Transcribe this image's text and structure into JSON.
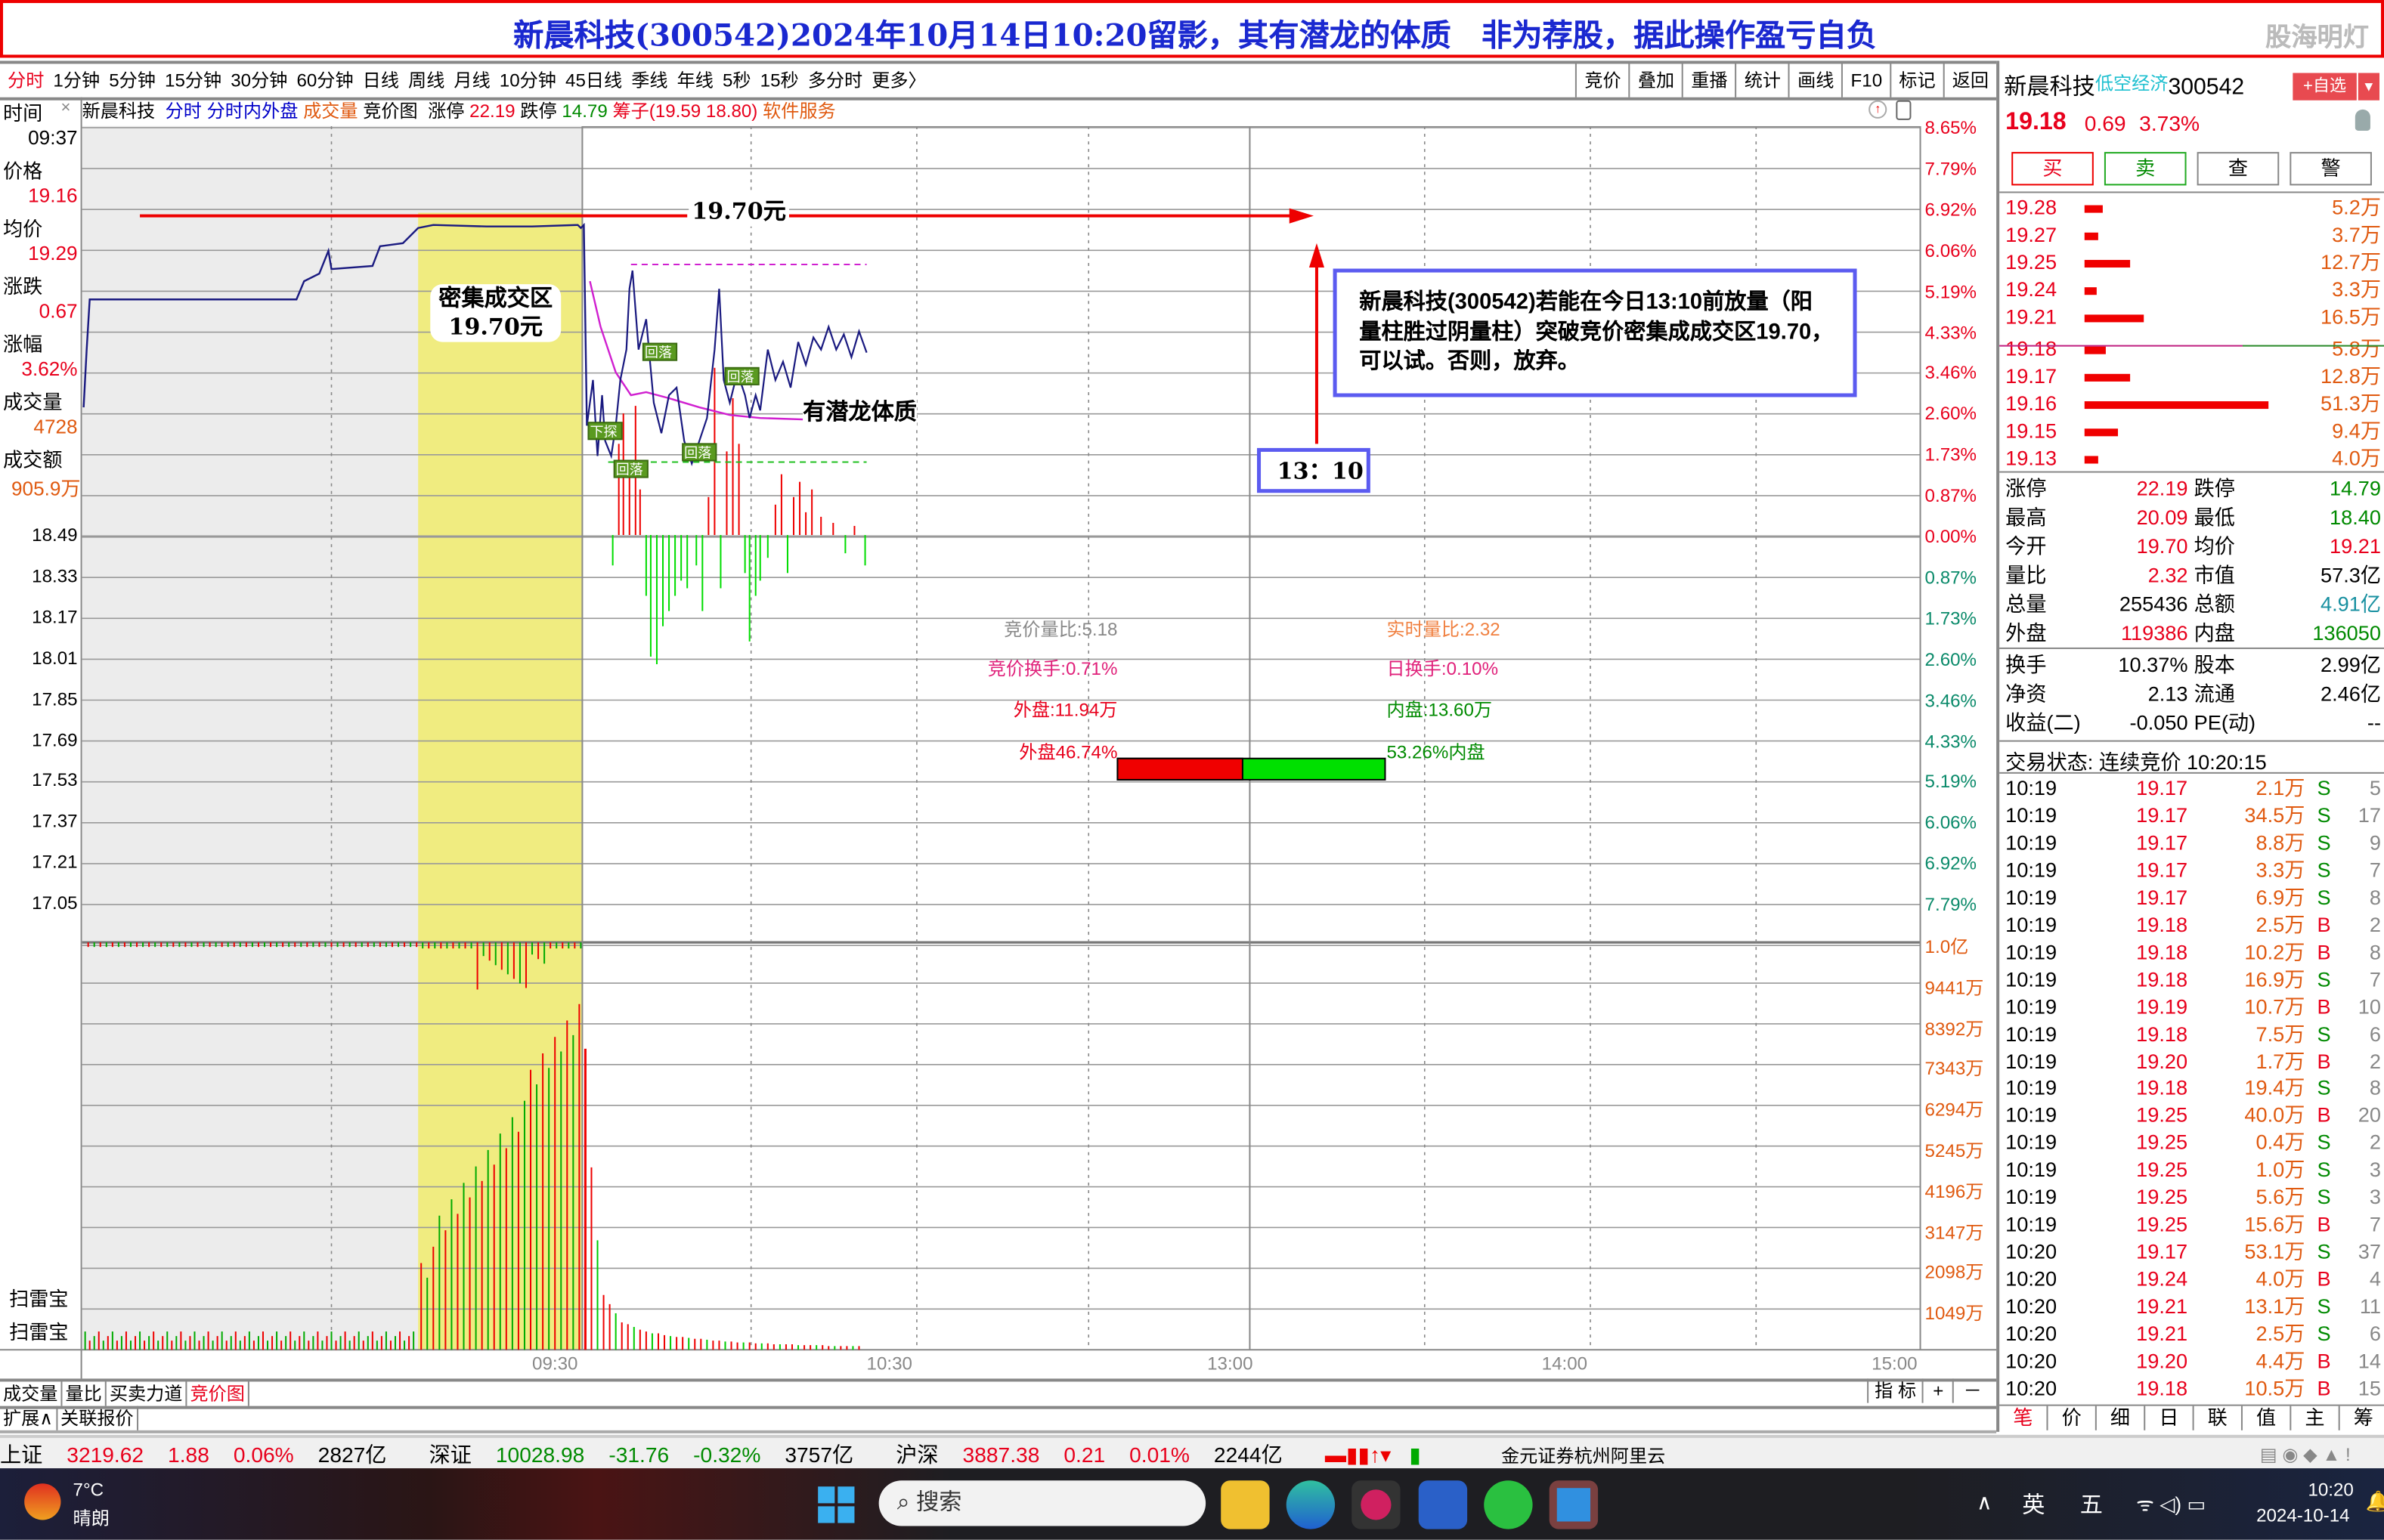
{
  "title": "新晨科技(300542)2024年10月14日10:20留影，其有潜龙的体质　非为荐股，据此操作盈亏自负",
  "watermark": "股海明灯",
  "periods": [
    "分时",
    "1分钟",
    "5分钟",
    "15分钟",
    "30分钟",
    "60分钟",
    "日线",
    "周线",
    "月线",
    "10分钟",
    "45日线",
    "季线",
    "年线",
    "5秒",
    "15秒",
    "多分时",
    "更多〉"
  ],
  "active_period": "分时",
  "tool_buttons": [
    "竞价",
    "叠加",
    "重播",
    "统计",
    "画线",
    "F10",
    "标记",
    "返回"
  ],
  "info_line": {
    "name": "新晨科技",
    "tab1": "分时",
    "tab2": "分时内外盘",
    "tab3": "成交量",
    "tab4": "竞价图",
    "limit_up_label": "涨停",
    "limit_up": "22.19",
    "limit_down_label": "跌停",
    "limit_down": "14.79",
    "chips": "筹子(19.59 18.80)",
    "service": "软件服务"
  },
  "left_panel": {
    "time_label": "时间",
    "time": "09:37",
    "price_label": "价格",
    "price": "19.16",
    "avg_label": "均价",
    "avg": "19.29",
    "change_label": "涨跌",
    "change": "0.67",
    "pct_label": "涨幅",
    "pct": "3.62%",
    "vol_label": "成交量",
    "vol": "4728",
    "amt_label": "成交额",
    "amt": "905.9万",
    "price_ticks_below": [
      "18.49",
      "18.33",
      "18.17",
      "18.01",
      "17.85",
      "17.69",
      "17.53",
      "17.37",
      "17.21",
      "17.05"
    ],
    "sweep1": "扫雷宝",
    "sweep2": "扫雷宝"
  },
  "right_axis": {
    "pct_up": [
      "8.65%",
      "7.79%",
      "6.92%",
      "6.06%",
      "5.19%",
      "4.33%",
      "3.46%",
      "2.60%",
      "1.73%",
      "0.87%",
      "0.00%"
    ],
    "pct_down": [
      "0.87%",
      "1.73%",
      "2.60%",
      "3.46%",
      "4.33%",
      "5.19%",
      "6.06%",
      "6.92%",
      "7.79%"
    ],
    "volume": [
      "1.0亿",
      "9441万",
      "8392万",
      "7343万",
      "6294万",
      "5245万",
      "4196万",
      "3147万",
      "2098万",
      "1049万"
    ]
  },
  "time_axis": [
    "09:30",
    "10:30",
    "13:00",
    "14:00",
    "15:00"
  ],
  "annotations": {
    "price_line_label": "19.70元",
    "zone_label_1": "密集成交区",
    "zone_label_2": "19.70元",
    "dragon": "有潜龙体质",
    "deadline": "13：10",
    "note": "新晨科技(300542)若能在今日13:10前放量（阳量柱胜过阴量柱）突破竞价密集成成交区19.70，可以试。否则，放弃。",
    "markers": [
      "下探",
      "回落",
      "回落",
      "回落",
      "回落"
    ]
  },
  "auction_stats": {
    "auction_ratio": "竞价量比:5.18",
    "realtime_ratio": "实时量比:2.32",
    "auction_turnover": "竞价换手:0.71%",
    "day_turnover": "日换手:0.10%",
    "outer": "外盘:11.94万",
    "inner": "内盘:13.60万",
    "outer_pct_label": "外盘46.74%",
    "inner_pct_label": "53.26%内盘",
    "outer_pct": 46.74
  },
  "bottom_tabs": [
    "成交量",
    "量比",
    "买卖力道",
    "竞价图"
  ],
  "active_bottom_tab": "竞价图",
  "ext_tabs": [
    "扩展∧",
    "关联报价"
  ],
  "indicator_buttons": [
    "指 标",
    "+",
    "－"
  ],
  "quote": {
    "name": "新晨科技",
    "concept": "低空经济",
    "code": "300542",
    "fav": "+自选",
    "price": "19.18",
    "change": "0.69",
    "pct": "3.73%",
    "actions": [
      "买",
      "卖",
      "查",
      "警"
    ],
    "asks": [
      [
        "19.28",
        "5.2万",
        5.2
      ],
      [
        "19.27",
        "3.7万",
        3.7
      ],
      [
        "19.25",
        "12.7万",
        12.7
      ],
      [
        "19.24",
        "3.3万",
        3.3
      ],
      [
        "19.21",
        "16.5万",
        16.5
      ]
    ],
    "bids": [
      [
        "19.18",
        "5.8万",
        5.8
      ],
      [
        "19.17",
        "12.8万",
        12.8
      ],
      [
        "19.16",
        "51.3万",
        51.3
      ],
      [
        "19.15",
        "9.4万",
        9.4
      ],
      [
        "19.13",
        "4.0万",
        4.0
      ]
    ],
    "stats": [
      [
        "涨停",
        "22.19",
        "red",
        "跌停",
        "14.79",
        "green"
      ],
      [
        "最高",
        "20.09",
        "red",
        "最低",
        "18.40",
        "green"
      ],
      [
        "今开",
        "19.70",
        "red",
        "均价",
        "19.21",
        "red"
      ],
      [
        "量比",
        "2.32",
        "red",
        "市值",
        "57.3亿",
        "black"
      ],
      [
        "总量",
        "255436",
        "black",
        "总额",
        "4.91亿",
        "teal"
      ],
      [
        "外盘",
        "119386",
        "red",
        "内盘",
        "136050",
        "green"
      ]
    ],
    "stats2": [
      [
        "换手",
        "10.37%",
        "black",
        "股本",
        "2.99亿",
        "black"
      ],
      [
        "净资",
        "2.13",
        "black",
        "流通",
        "2.46亿",
        "black"
      ],
      [
        "收益(二)",
        "-0.050",
        "black",
        "PE(动)",
        "--",
        "black"
      ]
    ],
    "status": "交易状态: 连续竞价 10:20:15",
    "trades": [
      [
        "10:19",
        "19.17",
        "2.1万",
        "S",
        "5"
      ],
      [
        "10:19",
        "19.17",
        "34.5万",
        "S",
        "17"
      ],
      [
        "10:19",
        "19.17",
        "8.8万",
        "S",
        "9"
      ],
      [
        "10:19",
        "19.17",
        "3.3万",
        "S",
        "7"
      ],
      [
        "10:19",
        "19.17",
        "6.9万",
        "S",
        "8"
      ],
      [
        "10:19",
        "19.18",
        "2.5万",
        "B",
        "2"
      ],
      [
        "10:19",
        "19.18",
        "10.2万",
        "B",
        "8"
      ],
      [
        "10:19",
        "19.18",
        "16.9万",
        "S",
        "7"
      ],
      [
        "10:19",
        "19.19",
        "10.7万",
        "B",
        "10"
      ],
      [
        "10:19",
        "19.18",
        "7.5万",
        "S",
        "6"
      ],
      [
        "10:19",
        "19.20",
        "1.7万",
        "B",
        "2"
      ],
      [
        "10:19",
        "19.18",
        "19.4万",
        "S",
        "8"
      ],
      [
        "10:19",
        "19.25",
        "40.0万",
        "B",
        "20"
      ],
      [
        "10:19",
        "19.25",
        "0.4万",
        "S",
        "2"
      ],
      [
        "10:19",
        "19.25",
        "1.0万",
        "S",
        "3"
      ],
      [
        "10:19",
        "19.25",
        "5.6万",
        "S",
        "3"
      ],
      [
        "10:19",
        "19.25",
        "15.6万",
        "B",
        "7"
      ],
      [
        "10:20",
        "19.17",
        "53.1万",
        "S",
        "37"
      ],
      [
        "10:20",
        "19.24",
        "4.0万",
        "B",
        "4"
      ],
      [
        "10:20",
        "19.21",
        "13.1万",
        "S",
        "11"
      ],
      [
        "10:20",
        "19.21",
        "2.5万",
        "S",
        "6"
      ],
      [
        "10:20",
        "19.20",
        "4.4万",
        "B",
        "14"
      ],
      [
        "10:20",
        "19.18",
        "10.5万",
        "B",
        "15"
      ]
    ],
    "tabs": [
      "笔",
      "价",
      "细",
      "日",
      "联",
      "值",
      "主",
      "筹"
    ],
    "active_tab": "笔"
  },
  "index_bar": {
    "sh": [
      "上证",
      "3219.62",
      "1.88",
      "0.06%",
      "2827亿"
    ],
    "sz": [
      "深证",
      "10028.98",
      "-31.76",
      "-0.32%",
      "3757亿"
    ],
    "hs": [
      "沪深",
      "3887.38",
      "0.21",
      "0.01%",
      "2244亿"
    ],
    "broker": "金元证券杭州阿里云"
  },
  "taskbar": {
    "temp": "7°C",
    "weather": "晴朗",
    "search": "搜索",
    "ime1": "英",
    "ime2": "五",
    "time": "10:20",
    "date": "2024-10-14"
  },
  "colors": {
    "up": "#e8001c",
    "down": "#00c800",
    "title": "#1a28d0",
    "highlight": "#f0ec80",
    "box": "#5b5bf0"
  }
}
